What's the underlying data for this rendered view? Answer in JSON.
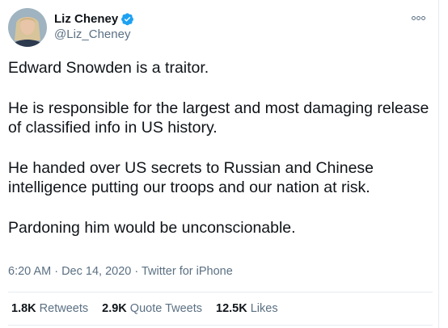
{
  "author": {
    "display_name": "Liz Cheney",
    "handle": "@Liz_Cheney",
    "verified": true
  },
  "tweet": {
    "paragraphs": [
      "Edward Snowden is a traitor.",
      "He is responsible for the largest and most damaging release of classified info in US history.",
      "He handed over US secrets to Russian and Chinese intelligence putting our troops and our nation at risk.",
      "Pardoning him would be unconscionable."
    ],
    "timestamp": "6:20 AM · Dec 14, 2020 · Twitter for iPhone"
  },
  "stats": {
    "retweets_count": "1.8K",
    "retweets_label": "Retweets",
    "quote_count": "2.9K",
    "quote_label": "Quote Tweets",
    "likes_count": "12.5K",
    "likes_label": "Likes"
  },
  "icons": {
    "verified": "verified-badge-icon",
    "more": "more-options-icon"
  },
  "colors": {
    "verified_blue": "#1da1f2",
    "secondary_text": "#5b7083",
    "divider": "#e6ecf0"
  }
}
